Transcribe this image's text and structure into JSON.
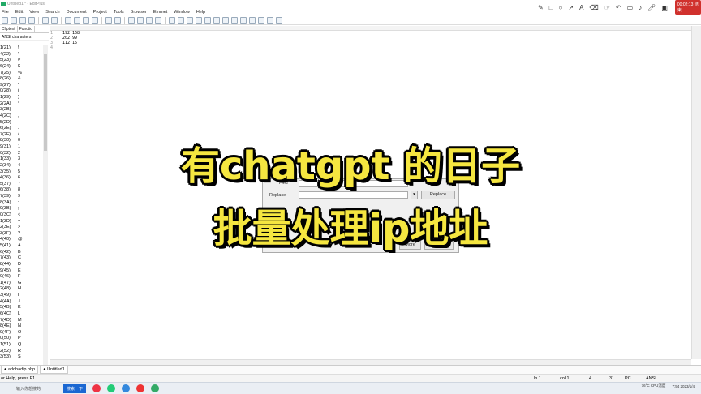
{
  "window": {
    "title": "Untitled1 * - EditPlus"
  },
  "menu": [
    "File",
    "Edit",
    "View",
    "Search",
    "Document",
    "Project",
    "Tools",
    "Browser",
    "Emmet",
    "Window",
    "Help"
  ],
  "recorder": {
    "timer": "00:02:13 结束"
  },
  "sidepanel": {
    "tabs": [
      "Cliptext",
      "Functio"
    ],
    "title": "ANSI characters",
    "rows": [
      {
        "code": "1(21)",
        "char": "!"
      },
      {
        "code": "4(22)",
        "char": "\""
      },
      {
        "code": "5(23)",
        "char": "#"
      },
      {
        "code": "6(24)",
        "char": "$"
      },
      {
        "code": "7(25)",
        "char": "%"
      },
      {
        "code": "8(26)",
        "char": "&"
      },
      {
        "code": "9(27)",
        "char": "'"
      },
      {
        "code": "0(28)",
        "char": "("
      },
      {
        "code": "1(29)",
        "char": ")"
      },
      {
        "code": "2(2A)",
        "char": "*"
      },
      {
        "code": "3(2B)",
        "char": "+"
      },
      {
        "code": "4(2C)",
        "char": ","
      },
      {
        "code": "5(2D)",
        "char": "-"
      },
      {
        "code": "6(2E)",
        "char": "."
      },
      {
        "code": "7(2F)",
        "char": "/"
      },
      {
        "code": "8(30)",
        "char": "0"
      },
      {
        "code": "9(31)",
        "char": "1"
      },
      {
        "code": "0(32)",
        "char": "2"
      },
      {
        "code": "1(33)",
        "char": "3"
      },
      {
        "code": "2(34)",
        "char": "4"
      },
      {
        "code": "3(35)",
        "char": "5"
      },
      {
        "code": "4(36)",
        "char": "6"
      },
      {
        "code": "5(37)",
        "char": "7"
      },
      {
        "code": "6(38)",
        "char": "8"
      },
      {
        "code": "7(39)",
        "char": "9"
      },
      {
        "code": "8(3A)",
        "char": ":"
      },
      {
        "code": "9(3B)",
        "char": ";"
      },
      {
        "code": "0(3C)",
        "char": "<"
      },
      {
        "code": "1(3D)",
        "char": "="
      },
      {
        "code": "2(3E)",
        "char": ">"
      },
      {
        "code": "3(3F)",
        "char": "?"
      },
      {
        "code": "4(40)",
        "char": "@"
      },
      {
        "code": "5(41)",
        "char": "A"
      },
      {
        "code": "6(42)",
        "char": "B"
      },
      {
        "code": "7(43)",
        "char": "C"
      },
      {
        "code": "8(44)",
        "char": "D"
      },
      {
        "code": "9(45)",
        "char": "E"
      },
      {
        "code": "0(46)",
        "char": "F"
      },
      {
        "code": "1(47)",
        "char": "G"
      },
      {
        "code": "2(48)",
        "char": "H"
      },
      {
        "code": "3(49)",
        "char": "I"
      },
      {
        "code": "4(4A)",
        "char": "J"
      },
      {
        "code": "5(4B)",
        "char": "K"
      },
      {
        "code": "6(4C)",
        "char": "L"
      },
      {
        "code": "7(4D)",
        "char": "M"
      },
      {
        "code": "8(4E)",
        "char": "N"
      },
      {
        "code": "9(4F)",
        "char": "O"
      },
      {
        "code": "0(50)",
        "char": "P"
      },
      {
        "code": "1(51)",
        "char": "Q"
      },
      {
        "code": "2(52)",
        "char": "R"
      },
      {
        "code": "3(53)",
        "char": "S"
      }
    ]
  },
  "editor": {
    "line_numbers": [
      "1",
      "2",
      "3",
      "4"
    ],
    "lines": [
      "192.168",
      "202.99",
      "112.15",
      ""
    ]
  },
  "dialog": {
    "find_label": "Find",
    "replace_label": "Replace",
    "replace_button": "Replace",
    "more_button": "More",
    "help_button": "Help"
  },
  "filetabs": [
    "addbadip.php",
    "Untitled1"
  ],
  "status": {
    "help": "or Help, press F1",
    "line": "ln 1",
    "col": "col 1",
    "num1": "4",
    "num2": "31",
    "mode": "PC",
    "encoding": "ANSI"
  },
  "taskbar": {
    "search_placeholder": "输入你想搜的",
    "search_button": "搜索一下",
    "temp": "76°C",
    "cpu": "CPU温度",
    "time": "7:54",
    "date": "2023/1/4"
  },
  "overlay_text": {
    "line1": "有chatgpt 的日子",
    "line2": "批量处理ip地址"
  }
}
